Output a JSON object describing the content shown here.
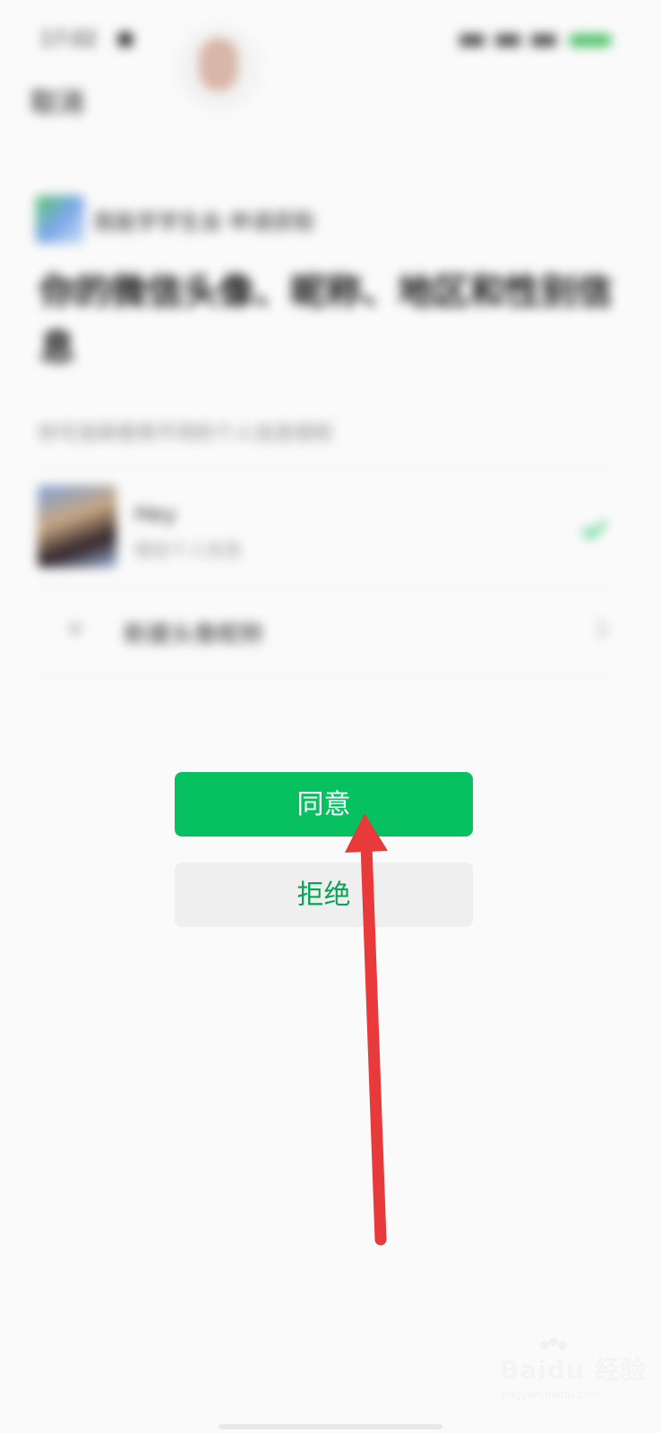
{
  "status_bar": {
    "time": "17:02"
  },
  "header": {
    "cancel_label": "取消"
  },
  "auth_request": {
    "app_line": "我能学学生会 申请获取",
    "title": "你的微信头像、昵称、地区和性别信息",
    "subtitle": "你可选择使用不同的个人信息授权"
  },
  "profile_options": [
    {
      "name": "Hey",
      "sub": "微信个人信息",
      "selected": true
    }
  ],
  "new_profile": {
    "label": "新建头像昵称"
  },
  "actions": {
    "agree_label": "同意",
    "reject_label": "拒绝"
  },
  "colors": {
    "primary_green": "#07c160",
    "reject_text_green": "#07a455",
    "arrow_red": "#e83a3a"
  },
  "watermark": {
    "brand": "Baidu 经验",
    "url": "jingyan.baidu.com"
  }
}
